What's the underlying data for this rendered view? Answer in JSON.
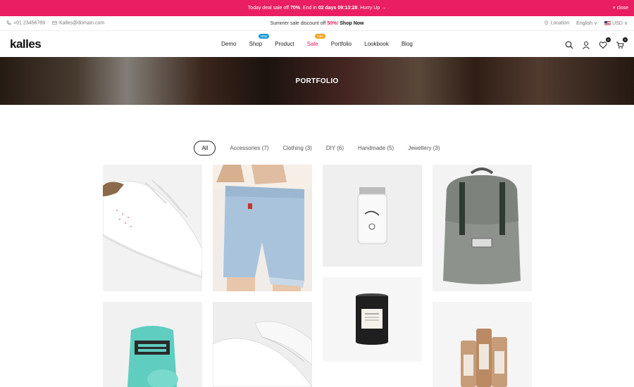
{
  "promo": {
    "text_before": "Today deal sale off ",
    "pct": "70%",
    "text_mid": ". End in ",
    "countdown": "02 days 09:13:28",
    "text_after": ". Hurry Up →",
    "close": "× close"
  },
  "topbar": {
    "phone": "+01 23456789",
    "email": "Kalles@domain.com",
    "notice_before": "Summer sale discount off ",
    "notice_pct": "50%",
    "notice_after": "! ",
    "shop_now": "Shop Now",
    "location": "Location",
    "language": "English ∨",
    "currency": "USD ∨"
  },
  "header": {
    "logo": "kalles",
    "nav": [
      {
        "label": "Demo"
      },
      {
        "label": "Shop",
        "badge": "New"
      },
      {
        "label": "Product"
      },
      {
        "label": "Sale",
        "badge": "Sale"
      },
      {
        "label": "Portfolio"
      },
      {
        "label": "Lookbook"
      },
      {
        "label": "Blog"
      }
    ],
    "wishlist_count": "0",
    "cart_count": "0"
  },
  "hero": {
    "title": "PORTFOLIO"
  },
  "filters": [
    "All",
    "Accessories (7)",
    "Clothing (3)",
    "DIY (6)",
    "Handmade (5)",
    "Jewellery (3)"
  ],
  "colors": {
    "accent": "#e91e63",
    "new_badge": "#1e9bd7",
    "sale_badge": "#f7a21b"
  },
  "gallery_icons": [
    "white-sneaker-image",
    "denim-shorts-image",
    "glass-jar-image",
    "grey-backpack-image",
    "shoe-cleaner-image",
    "white-sneaker-sole-image",
    "candle-image",
    "paper-tubes-image"
  ]
}
